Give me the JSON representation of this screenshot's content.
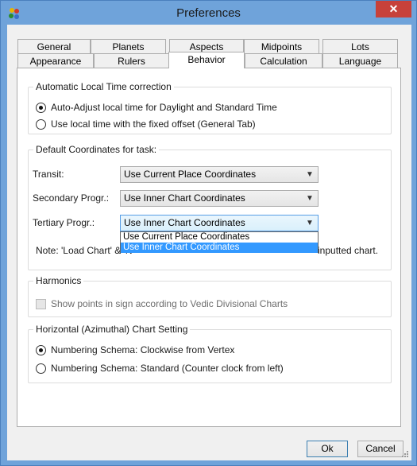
{
  "window": {
    "title": "Preferences",
    "close_label": "✕",
    "app_icon": "app-icon"
  },
  "tabs": {
    "row1": [
      "General",
      "Planets",
      "Aspects",
      "Midpoints",
      "Lots"
    ],
    "row2": [
      "Appearance",
      "Rulers",
      "Behavior",
      "Calculation",
      "Language"
    ],
    "selected": "Behavior"
  },
  "auto_time": {
    "title": "Automatic Local Time correction",
    "opt1": "Auto-Adjust local time for Daylight and Standard Time",
    "opt2": "Use local time with the fixed offset (General Tab)",
    "selected": 1
  },
  "coords": {
    "title": "Default Coordinates for  task:",
    "transit_label": "Transit:",
    "transit_value": "Use Current Place Coordinates",
    "secondary_label": "Secondary Progr.:",
    "secondary_value": "Use Inner Chart Coordinates",
    "tertiary_label": "Tertiary Progr.:",
    "tertiary_value": "Use Inner Chart Coordinates",
    "dropdown_options": [
      "Use Current Place Coordinates",
      "Use Inner Chart Coordinates"
    ],
    "dropdown_highlighted": "Use Inner Chart Coordinates",
    "note_left": "Note:  'Load Chart' & 'N",
    "note_right": "inputted chart."
  },
  "harmonics": {
    "title": "Harmonics",
    "checkbox_label": "Show points in sign according  to Vedic Divisional Charts",
    "checked": false,
    "enabled": false
  },
  "horizontal": {
    "title": "Horizontal (Azimuthal) Chart Setting",
    "opt1": "Numbering Schema: Clockwise from Vertex",
    "opt2": "Numbering Schema: Standard (Counter clock from left)",
    "selected": 1
  },
  "buttons": {
    "ok": "Ok",
    "cancel": "Cancel"
  },
  "colors": {
    "selection": "#3399ff",
    "frame": "#6fa3da",
    "close": "#c7413a"
  }
}
